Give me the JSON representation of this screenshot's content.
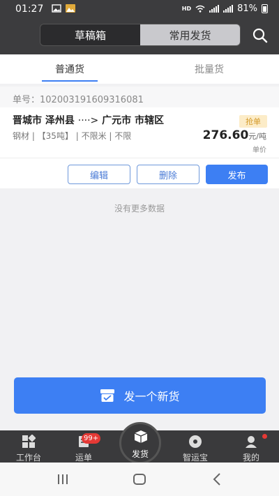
{
  "status": {
    "time": "01:27",
    "hd": "HD",
    "battery": "81%"
  },
  "header": {
    "segments": [
      {
        "label": "草稿箱",
        "active": true
      },
      {
        "label": "常用发货",
        "active": false
      }
    ]
  },
  "tabs": [
    {
      "label": "普通货",
      "active": true
    },
    {
      "label": "批量货",
      "active": false
    }
  ],
  "order": {
    "number_label": "单号：102003191609316081",
    "route_from": "晋城市 泽州县",
    "route_arrow": "····>",
    "route_to": "广元市 市辖区",
    "specs": "钢材 | 【35吨】 | 不限米 | 不限",
    "tag": "抢单",
    "price": "276.60",
    "price_unit": "元/吨",
    "price_label": "单价",
    "actions": {
      "edit": "编辑",
      "delete": "删除",
      "publish": "发布"
    }
  },
  "empty_text": "没有更多数据",
  "new_goods_button": "发一个新货",
  "bottom_nav": {
    "workbench": "工作台",
    "waybill": "运单",
    "waybill_badge": "99+",
    "ship": "发货",
    "zhiyunbao": "智运宝",
    "mine": "我的"
  },
  "colors": {
    "accent": "#3d7ff3",
    "header": "#3c3c3e",
    "tag_bg": "#fcecc8",
    "tag_text": "#d49a2a"
  }
}
